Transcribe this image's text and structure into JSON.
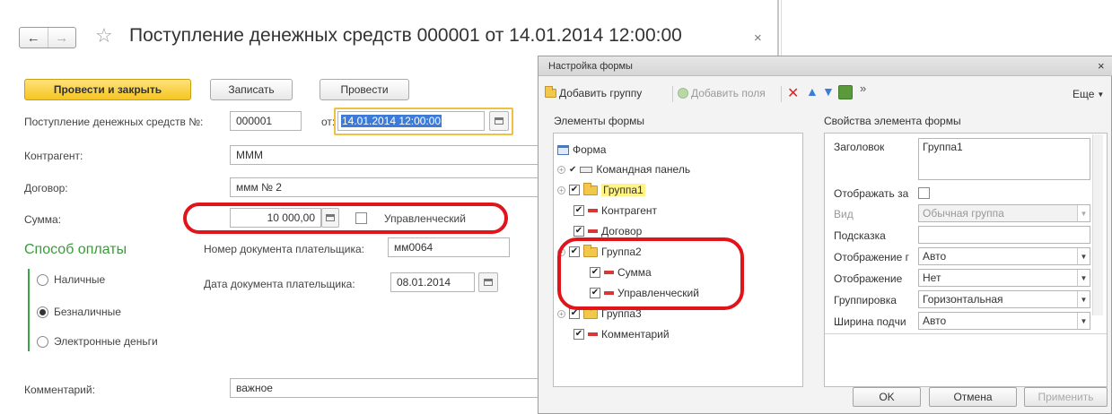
{
  "window": {
    "title": "Поступление денежных средств 000001 от 14.01.2014 12:00:00",
    "close_icon": "×"
  },
  "toolbar": {
    "post_close_label": "Провести и закрыть",
    "save_label": "Записать",
    "post_label": "Провести"
  },
  "form": {
    "number_label": "Поступление денежных средств №:",
    "number_value": "000001",
    "date_label": "от:",
    "date_value": "14.01.2014 12:00:00",
    "counterparty_label": "Контрагент:",
    "counterparty_value": "МММ",
    "contract_label": "Договор:",
    "contract_value": "ммм № 2",
    "sum_label": "Сумма:",
    "sum_value": "10 000,00",
    "managerial_label": "Управленческий",
    "payment_section_title": "Способ оплаты",
    "payer_doc_number_label": "Номер документа плательщика:",
    "payer_doc_number_value": "мм0064",
    "payer_doc_date_label": "Дата документа плательщика:",
    "payer_doc_date_value": "08.01.2014",
    "payment_options": [
      "Наличные",
      "Безналичные",
      "Электронные деньги"
    ],
    "payment_selected": "Безналичные",
    "comment_label": "Комментарий:",
    "comment_value": "важное"
  },
  "dialog": {
    "title": "Настройка формы",
    "close_icon": "×",
    "toolbar": {
      "add_group": "Добавить группу",
      "add_fields": "Добавить поля",
      "more": "Еще",
      "more_arrows": "»"
    },
    "elements_header": "Элементы формы",
    "properties_header": "Свойства элемента формы",
    "tree": {
      "form": "Форма",
      "command_panel": "Командная панель",
      "group1": "Группа1",
      "counterparty": "Контрагент",
      "contract": "Договор",
      "group2": "Группа2",
      "sum": "Сумма",
      "managerial": "Управленческий",
      "group3": "Группа3",
      "comment": "Комментарий"
    },
    "properties": {
      "header_label": "Заголовок",
      "header_value": "Группа1",
      "show_header_label": "Отображать за",
      "view_label": "Вид",
      "view_value": "Обычная группа",
      "hint_label": "Подсказка",
      "display_group_label": "Отображение г",
      "display_group_value": "Авто",
      "display_label": "Отображение",
      "display_value": "Нет",
      "grouping_label": "Группировка",
      "grouping_value": "Горизонтальная",
      "sub_width_label": "Ширина подчи",
      "sub_width_value": "Авто"
    },
    "buttons": {
      "ok": "OK",
      "cancel": "Отмена",
      "apply": "Применить"
    }
  },
  "colors": {
    "accent_yellow": "#f5c522",
    "section_green": "#3a9a3a",
    "highlight_red": "#e0141a",
    "selection_blue": "#3d7bd8"
  }
}
